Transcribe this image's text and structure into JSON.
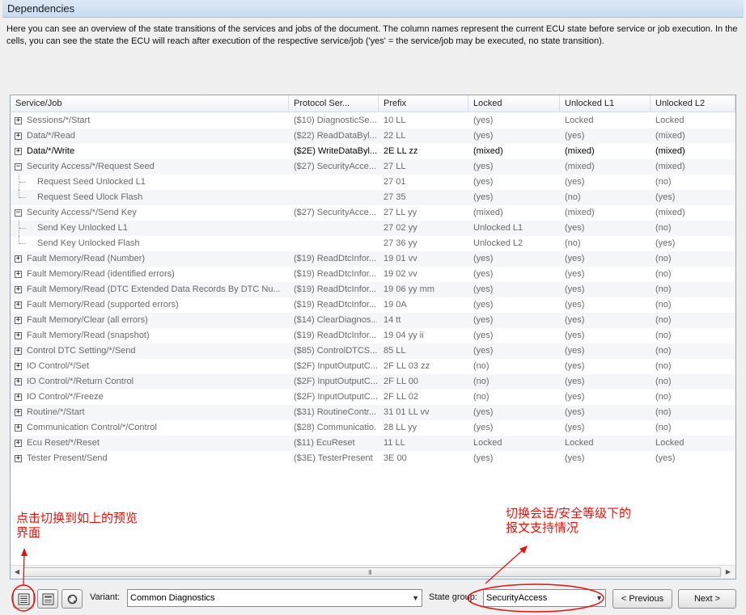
{
  "panel": {
    "title": "Dependencies",
    "description": "Here you can see an overview of the state transitions of the services and jobs of the document. The column names represent the current ECU state before service or job execution. In the cells, you can see the state the ECU will reach after execution of the respective service/job ('yes' = the service/job may be executed, no state transition)."
  },
  "table": {
    "columns": [
      "Service/Job",
      "Protocol Ser...",
      "Prefix",
      "Locked",
      "Unlocked L1",
      "Unlocked L2"
    ],
    "rows": [
      {
        "service": "Sessions/*/Start",
        "protocol": "($10) DiagnosticSe...",
        "prefix": "10 LL",
        "locked": "(yes)",
        "l1": "Locked",
        "l2": "Locked",
        "expander": "+",
        "level": 0
      },
      {
        "service": "Data/*/Read",
        "protocol": "($22) ReadDataByl...",
        "prefix": "22 LL",
        "locked": "(yes)",
        "l1": "(yes)",
        "l2": "(mixed)",
        "expander": "+",
        "level": 0
      },
      {
        "service": "Data/*/Write",
        "protocol": "($2E) WriteDataByl...",
        "prefix": "2E LL zz",
        "locked": "(mixed)",
        "l1": "(mixed)",
        "l2": "(mixed)",
        "expander": "+",
        "level": 0,
        "selected": true
      },
      {
        "service": "Security Access/*/Request Seed",
        "protocol": "($27) SecurityAcce...",
        "prefix": "27 LL",
        "locked": "(yes)",
        "l1": "(mixed)",
        "l2": "(mixed)",
        "expander": "−",
        "level": 0
      },
      {
        "service": "Request Seed Unlocked L1",
        "protocol": "",
        "prefix": "27 01",
        "locked": "(yes)",
        "l1": "(yes)",
        "l2": "(no)",
        "expander": "",
        "level": 1
      },
      {
        "service": "Request Seed Ulock Flash",
        "protocol": "",
        "prefix": "27 35",
        "locked": "(yes)",
        "l1": "(no)",
        "l2": "(yes)",
        "expander": "",
        "level": 1,
        "last": true
      },
      {
        "service": "Security Access/*/Send Key",
        "protocol": "($27) SecurityAcce...",
        "prefix": "27 LL yy",
        "locked": "(mixed)",
        "l1": "(mixed)",
        "l2": "(mixed)",
        "expander": "−",
        "level": 0
      },
      {
        "service": "Send Key Unlocked L1",
        "protocol": "",
        "prefix": "27 02 yy",
        "locked": "Unlocked L1",
        "l1": "(yes)",
        "l2": "(no)",
        "expander": "",
        "level": 1
      },
      {
        "service": "Send Key Unlocked Flash",
        "protocol": "",
        "prefix": "27 36 yy",
        "locked": "Unlocked L2",
        "l1": "(no)",
        "l2": "(yes)",
        "expander": "",
        "level": 1,
        "last": true
      },
      {
        "service": "Fault Memory/Read (Number)",
        "protocol": "($19) ReadDtcInfor...",
        "prefix": "19 01 vv",
        "locked": "(yes)",
        "l1": "(yes)",
        "l2": "(no)",
        "expander": "+",
        "level": 0
      },
      {
        "service": "Fault Memory/Read (identified errors)",
        "protocol": "($19) ReadDtcInfor...",
        "prefix": "19 02 vv",
        "locked": "(yes)",
        "l1": "(yes)",
        "l2": "(no)",
        "expander": "+",
        "level": 0
      },
      {
        "service": "Fault Memory/Read (DTC Extended Data Records By DTC Nu...",
        "protocol": "($19) ReadDtcInfor...",
        "prefix": "19 06 yy mm",
        "locked": "(yes)",
        "l1": "(yes)",
        "l2": "(no)",
        "expander": "+",
        "level": 0
      },
      {
        "service": "Fault Memory/Read (supported errors)",
        "protocol": "($19) ReadDtcInfor...",
        "prefix": "19 0A",
        "locked": "(yes)",
        "l1": "(yes)",
        "l2": "(no)",
        "expander": "+",
        "level": 0
      },
      {
        "service": "Fault Memory/Clear (all errors)",
        "protocol": "($14) ClearDiagnos...",
        "prefix": "14 tt",
        "locked": "(yes)",
        "l1": "(yes)",
        "l2": "(no)",
        "expander": "+",
        "level": 0
      },
      {
        "service": "Fault Memory/Read (snapshot)",
        "protocol": "($19) ReadDtcInfor...",
        "prefix": "19 04 yy ii",
        "locked": "(yes)",
        "l1": "(yes)",
        "l2": "(no)",
        "expander": "+",
        "level": 0
      },
      {
        "service": "Control DTC Setting/*/Send",
        "protocol": "($85) ControlDTCS...",
        "prefix": "85 LL",
        "locked": "(yes)",
        "l1": "(yes)",
        "l2": "(no)",
        "expander": "+",
        "level": 0
      },
      {
        "service": "IO Control/*/Set",
        "protocol": "($2F) InputOutputC...",
        "prefix": "2F LL 03 zz",
        "locked": "(no)",
        "l1": "(yes)",
        "l2": "(no)",
        "expander": "+",
        "level": 0
      },
      {
        "service": "IO Control/*/Return Control",
        "protocol": "($2F) InputOutputC...",
        "prefix": "2F LL 00",
        "locked": "(no)",
        "l1": "(yes)",
        "l2": "(no)",
        "expander": "+",
        "level": 0
      },
      {
        "service": "IO Control/*/Freeze",
        "protocol": "($2F) InputOutputC...",
        "prefix": "2F LL 02",
        "locked": "(no)",
        "l1": "(yes)",
        "l2": "(no)",
        "expander": "+",
        "level": 0
      },
      {
        "service": "Routine/*/Start",
        "protocol": "($31) RoutineContr...",
        "prefix": "31 01 LL vv",
        "locked": "(yes)",
        "l1": "(yes)",
        "l2": "(no)",
        "expander": "+",
        "level": 0
      },
      {
        "service": "Communication Control/*/Control",
        "protocol": "($28) Communicatio...",
        "prefix": "28 LL yy",
        "locked": "(yes)",
        "l1": "(yes)",
        "l2": "(no)",
        "expander": "+",
        "level": 0
      },
      {
        "service": "Ecu Reset/*/Reset",
        "protocol": "($11) EcuReset",
        "prefix": "11 LL",
        "locked": "Locked",
        "l1": "Locked",
        "l2": "Locked",
        "expander": "+",
        "level": 0
      },
      {
        "service": "Tester Present/Send",
        "protocol": "($3E) TesterPresent",
        "prefix": "3E 00",
        "locked": "(yes)",
        "l1": "(yes)",
        "l2": "(yes)",
        "expander": "+",
        "level": 0
      }
    ]
  },
  "scrollbar": {
    "grip": "III"
  },
  "toolbar": {
    "icons": [
      "table-view-icon",
      "form-view-icon",
      "graph-view-icon"
    ],
    "variant_label": "Variant:",
    "variant_value": "Common Diagnostics",
    "state_group_label": "State group:",
    "state_group_value": "SecurityAccess",
    "previous_label": "< Previous",
    "next_label": "Next >"
  },
  "annotations": {
    "left_note": "点击切换到如上的预览界面",
    "right_note": "切换会话/安全等级下的报文支持情况",
    "color": "#e8120c"
  }
}
